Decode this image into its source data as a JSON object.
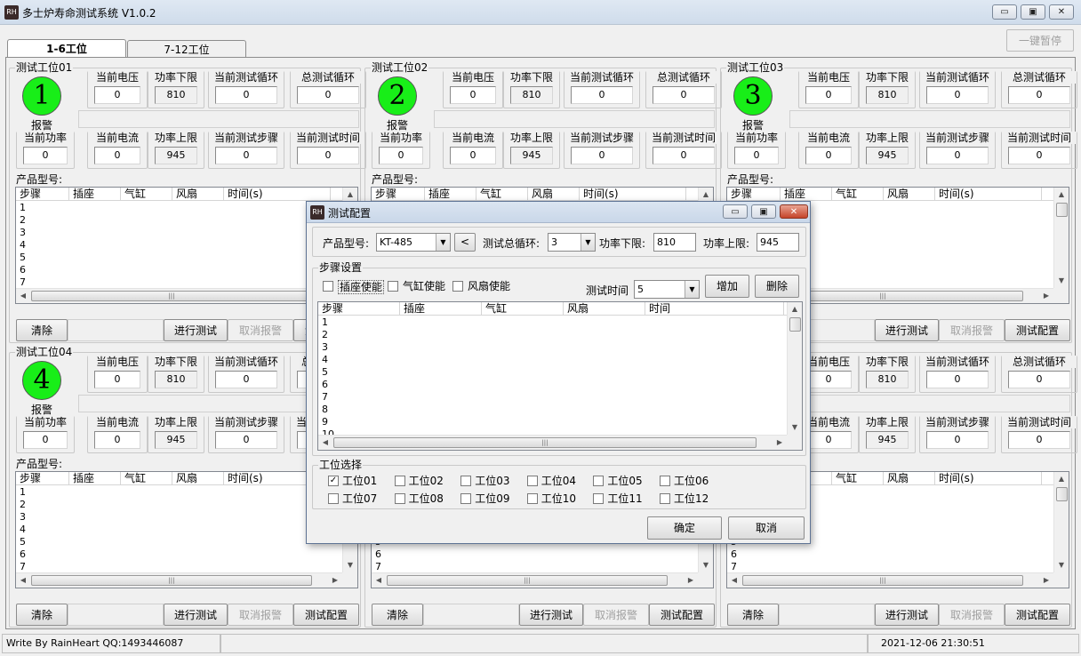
{
  "app": {
    "title": "多士炉寿命测试系统 V1.0.2",
    "icon_text": "RH"
  },
  "window": {
    "minimize_icon": "minimize-icon",
    "maximize_icon": "maximize-icon",
    "close_icon": "close-icon"
  },
  "toolbar": {
    "pause_all_label": "一键暂停"
  },
  "tabs": [
    {
      "label": "1-6工位"
    },
    {
      "label": "7-12工位"
    }
  ],
  "labels": {
    "alarm": "报警",
    "voltage": "当前电压",
    "power_low": "功率下限",
    "cycle_now": "当前测试循环",
    "cycle_total": "总测试循环",
    "power_now": "当前功率",
    "current_now": "当前电流",
    "power_high": "功率上限",
    "step_now": "当前测试步骤",
    "time_now": "当前测试时间",
    "model": "产品型号:"
  },
  "stations": [
    {
      "title": "测试工位01",
      "number": "1",
      "voltage": "0",
      "power_low": "810",
      "cycle_now": "0",
      "cycle_total": "0",
      "power_now": "0",
      "current_now": "0",
      "power_high": "945",
      "step_now": "0",
      "time_now": "0"
    },
    {
      "title": "测试工位02",
      "number": "2",
      "voltage": "0",
      "power_low": "810",
      "cycle_now": "0",
      "cycle_total": "0",
      "power_now": "0",
      "current_now": "0",
      "power_high": "945",
      "step_now": "0",
      "time_now": "0"
    },
    {
      "title": "测试工位03",
      "number": "3",
      "voltage": "0",
      "power_low": "810",
      "cycle_now": "0",
      "cycle_total": "0",
      "power_now": "0",
      "current_now": "0",
      "power_high": "945",
      "step_now": "0",
      "time_now": "0"
    },
    {
      "title": "测试工位04",
      "number": "4",
      "voltage": "0",
      "power_low": "810",
      "cycle_now": "0",
      "cycle_total": "0",
      "power_now": "0",
      "current_now": "0",
      "power_high": "945",
      "step_now": "0",
      "time_now": "0"
    },
    {
      "title": "",
      "number": "",
      "voltage": "0",
      "power_low": "810",
      "cycle_now": "0",
      "cycle_total": "0",
      "power_now": "0",
      "current_now": "0",
      "power_high": "945",
      "step_now": "0",
      "time_now": "0"
    },
    {
      "title": "",
      "number": "",
      "voltage": "0",
      "power_low": "810",
      "cycle_now": "0",
      "cycle_total": "0",
      "power_now": "0",
      "current_now": "0",
      "power_high": "945",
      "step_now": "0",
      "time_now": "0"
    }
  ],
  "table": {
    "columns": [
      "步骤",
      "插座",
      "气缸",
      "风扇",
      "时间(s)"
    ],
    "rows": [
      "1",
      "2",
      "3",
      "4",
      "5",
      "6",
      "7",
      "8"
    ]
  },
  "buttons": {
    "clear": "清除",
    "start_test": "进行测试",
    "cancel_alarm": "取消报警",
    "test_config": "测试配置",
    "config_partial": "测"
  },
  "dialog": {
    "title": "测试配置",
    "icon_text": "RH",
    "model_label": "产品型号:",
    "model_value": "KT-485",
    "back_label": "<",
    "cycles_label": "测试总循环:",
    "cycles_value": "3",
    "power_low_label": "功率下限:",
    "power_low_value": "810",
    "power_high_label": "功率上限:",
    "power_high_value": "945",
    "step_group": "步骤设置",
    "socket_enable": "插座使能",
    "cylinder_enable": "气缸使能",
    "fan_enable": "风扇使能",
    "test_time_label": "测试时间",
    "test_time_value": "5",
    "add_label": "增加",
    "delete_label": "删除",
    "columns": [
      "步骤",
      "插座",
      "气缸",
      "风扇",
      "时间"
    ],
    "rows": [
      "1",
      "2",
      "3",
      "4",
      "5",
      "6",
      "7",
      "8",
      "9",
      "10"
    ],
    "station_group": "工位选择",
    "stations": [
      {
        "label": "工位01",
        "checked": true
      },
      {
        "label": "工位02",
        "checked": false
      },
      {
        "label": "工位03",
        "checked": false
      },
      {
        "label": "工位04",
        "checked": false
      },
      {
        "label": "工位05",
        "checked": false
      },
      {
        "label": "工位06",
        "checked": false
      },
      {
        "label": "工位07",
        "checked": false
      },
      {
        "label": "工位08",
        "checked": false
      },
      {
        "label": "工位09",
        "checked": false
      },
      {
        "label": "工位10",
        "checked": false
      },
      {
        "label": "工位11",
        "checked": false
      },
      {
        "label": "工位12",
        "checked": false
      }
    ],
    "check_mark": "✓",
    "ok_label": "确定",
    "cancel_label": "取消"
  },
  "status": {
    "author": "Write By RainHeart  QQ:1493446087",
    "datetime": "2021-12-06   21:30:51"
  },
  "colors": {
    "indicator": "#18ee18",
    "window_border": "#5e7394"
  }
}
